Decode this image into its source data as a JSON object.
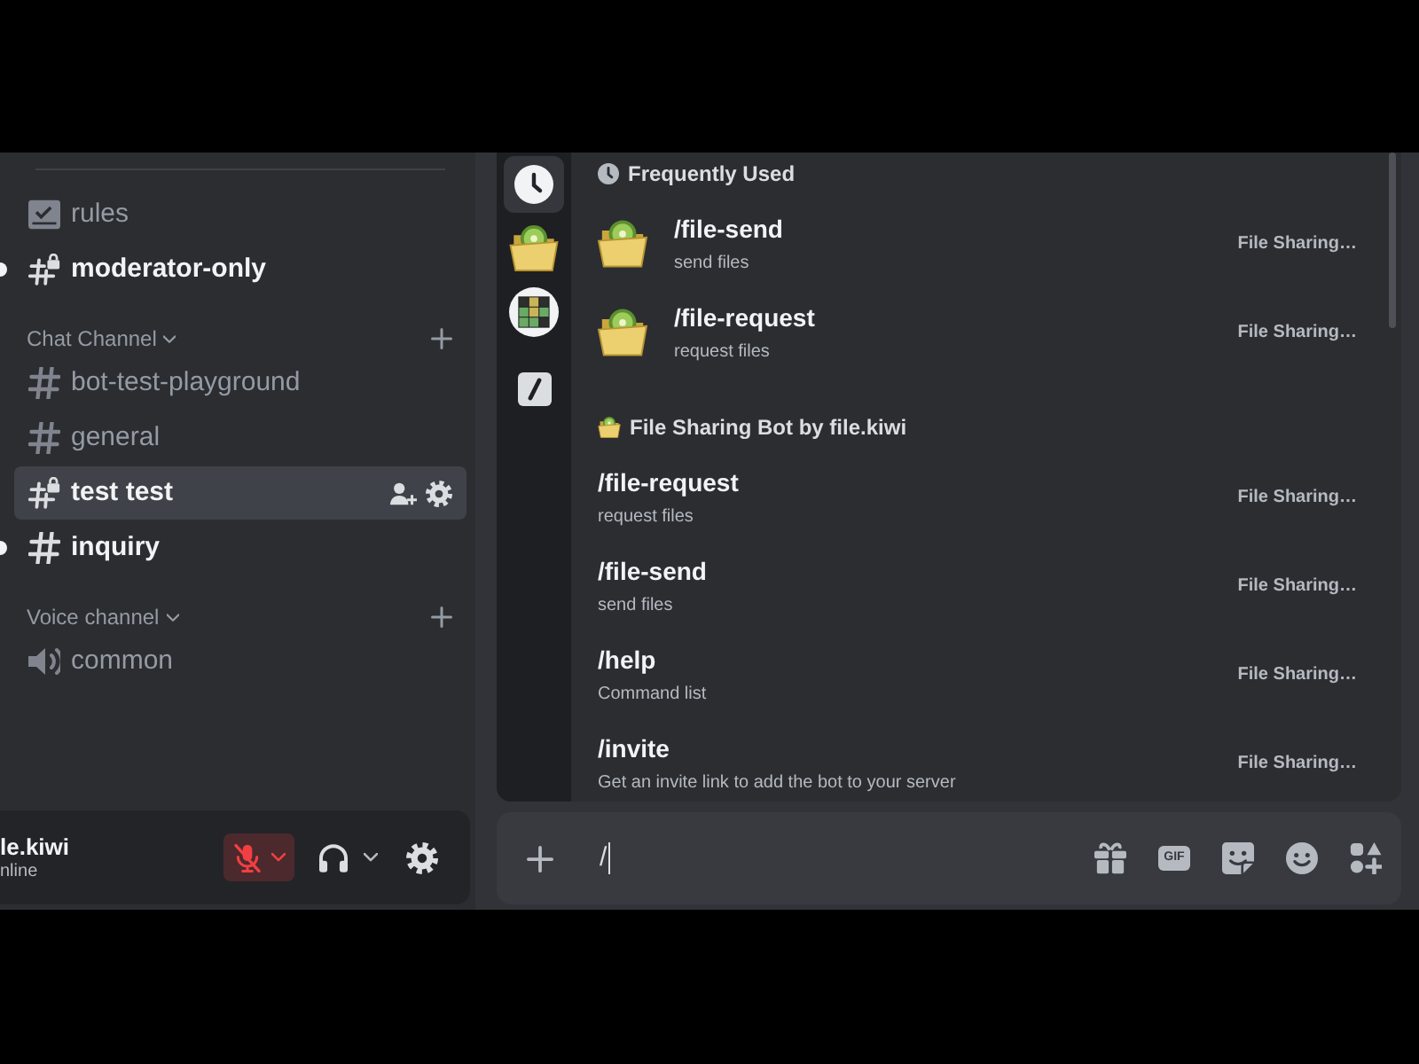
{
  "sidebar": {
    "channels": [
      {
        "kind": "rules",
        "name": "rules",
        "unread": false,
        "selected": false
      },
      {
        "kind": "locked_text",
        "name": "moderator-only",
        "unread": true,
        "selected": false
      }
    ],
    "categories": [
      {
        "name": "Chat Channel",
        "expanded": true,
        "channels": [
          {
            "kind": "text",
            "name": "bot-test-playground",
            "unread": false,
            "selected": false
          },
          {
            "kind": "text",
            "name": "general",
            "unread": false,
            "selected": false
          },
          {
            "kind": "locked_text",
            "name": "test test",
            "unread": false,
            "selected": true
          },
          {
            "kind": "text",
            "name": "inquiry",
            "unread": true,
            "selected": false
          }
        ]
      },
      {
        "name": "Voice channel",
        "expanded": true,
        "channels": [
          {
            "kind": "voice",
            "name": "common",
            "unread": false,
            "selected": false
          }
        ]
      }
    ]
  },
  "user_panel": {
    "name": "le.kiwi",
    "status": "nline",
    "muted": true
  },
  "command_picker": {
    "rail": [
      {
        "kind": "frequent",
        "selected": true
      },
      {
        "kind": "bot",
        "selected": false
      },
      {
        "kind": "app",
        "selected": false
      },
      {
        "kind": "built_in",
        "selected": false
      }
    ],
    "sections": [
      {
        "kind": "frequent",
        "title": "Frequently Used",
        "commands": [
          {
            "name": "/file-send",
            "description": "send files",
            "source": "File Sharing…"
          },
          {
            "name": "/file-request",
            "description": "request files",
            "source": "File Sharing…"
          }
        ]
      },
      {
        "kind": "bot",
        "title": "File Sharing Bot by file.kiwi",
        "commands": [
          {
            "name": "/file-request",
            "description": "request files",
            "source": "File Sharing…"
          },
          {
            "name": "/file-send",
            "description": "send files",
            "source": "File Sharing…"
          },
          {
            "name": "/help",
            "description": "Command list",
            "source": "File Sharing…"
          },
          {
            "name": "/invite",
            "description": "Get an invite link to add the bot to your server",
            "source": "File Sharing…"
          }
        ]
      }
    ]
  },
  "message_bar": {
    "value": "/",
    "gif_label": "GIF"
  }
}
